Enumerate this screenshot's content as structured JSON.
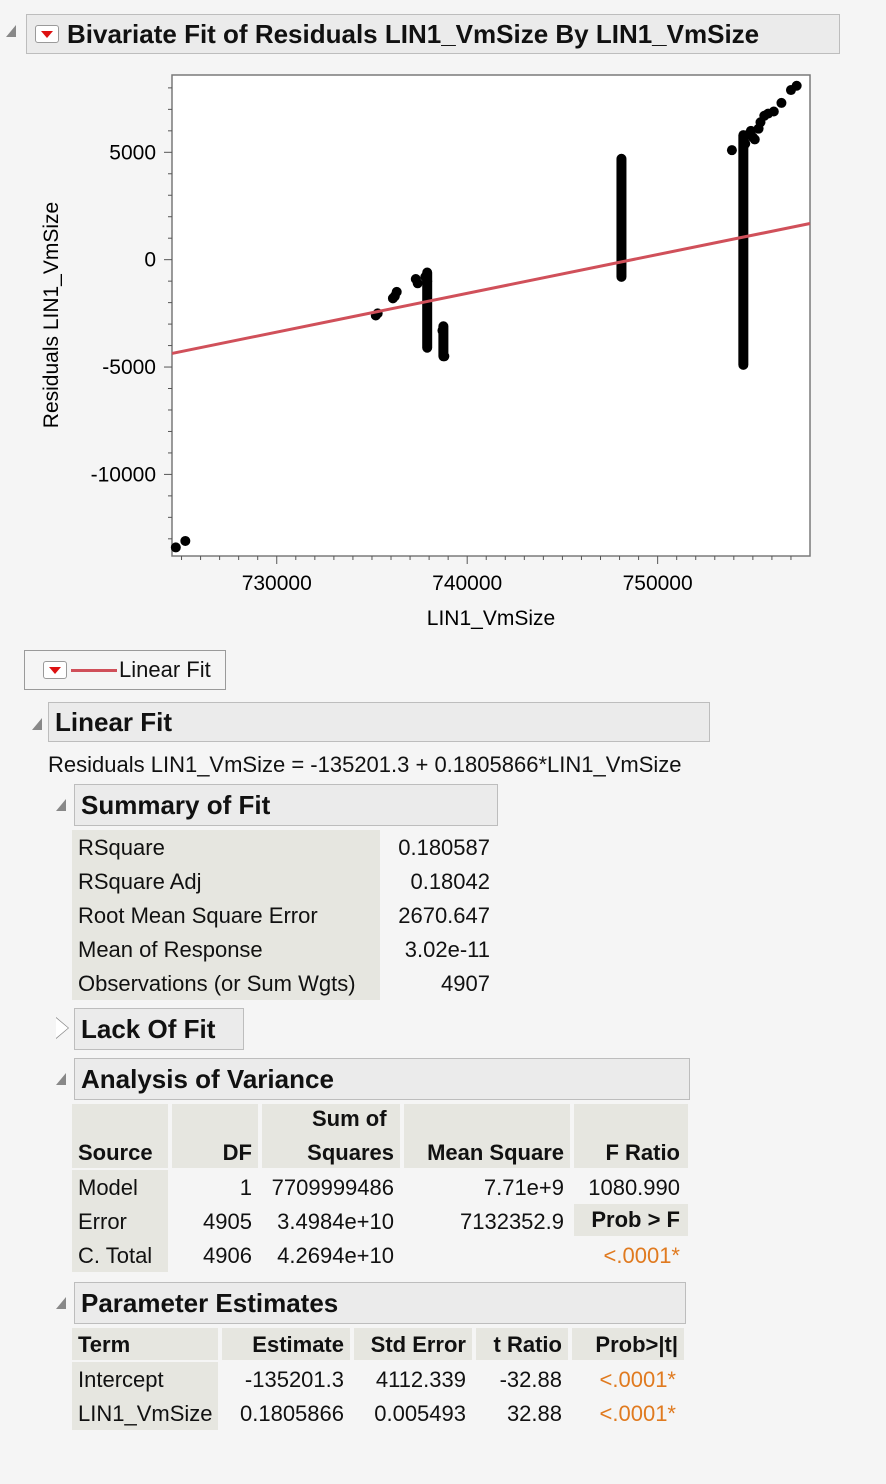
{
  "report": {
    "title": "Bivariate Fit of Residuals LIN1_VmSize By LIN1_VmSize"
  },
  "chart_data": {
    "type": "scatter",
    "xlabel": "LIN1_VmSize",
    "ylabel": "Residuals LIN1_VmSize",
    "xlim": [
      724500,
      758000
    ],
    "ylim": [
      -13800,
      8600
    ],
    "x_ticks": [
      "730000",
      "740000",
      "750000"
    ],
    "x_tick_values": [
      730000,
      740000,
      750000
    ],
    "y_ticks": [
      "5000",
      "0",
      "-5000",
      "-10000"
    ],
    "y_tick_values": [
      5000,
      0,
      -5000,
      -10000
    ],
    "fit_line": {
      "name": "Linear Fit",
      "intercept": -135201.3,
      "slope": 0.1805866,
      "color": "#d0505a"
    },
    "points": [
      [
        724700,
        -13400
      ],
      [
        725200,
        -13100
      ],
      [
        735200,
        -2600
      ],
      [
        735300,
        -2500
      ],
      [
        736200,
        -1700
      ],
      [
        736300,
        -1500
      ],
      [
        736100,
        -1800
      ],
      [
        737300,
        -900
      ],
      [
        737400,
        -1100
      ],
      [
        737800,
        -800
      ],
      [
        737900,
        -1000
      ],
      [
        738700,
        -3300
      ],
      [
        738800,
        -4500
      ],
      [
        753900,
        5100
      ],
      [
        754600,
        5400
      ],
      [
        754700,
        5800
      ],
      [
        754900,
        6000
      ],
      [
        755000,
        5700
      ],
      [
        755100,
        5600
      ],
      [
        755300,
        6100
      ],
      [
        755400,
        6400
      ],
      [
        755600,
        6700
      ],
      [
        755800,
        6800
      ],
      [
        756100,
        6900
      ],
      [
        756500,
        7300
      ],
      [
        757000,
        7900
      ],
      [
        757300,
        8100
      ]
    ],
    "vertical_clusters": [
      {
        "x": 737900,
        "ymin": -4100,
        "ymax": -600
      },
      {
        "x": 738750,
        "ymin": -4500,
        "ymax": -3100
      },
      {
        "x": 748100,
        "ymin": -800,
        "ymax": 4700
      },
      {
        "x": 754500,
        "ymin": -4900,
        "ymax": 5800
      }
    ]
  },
  "legend": {
    "label": "Linear Fit",
    "color": "#d0505a"
  },
  "linear_fit": {
    "title": "Linear Fit",
    "equation": "Residuals LIN1_VmSize = -135201.3 + 0.1805866*LIN1_VmSize"
  },
  "summary_of_fit": {
    "title": "Summary of Fit",
    "rows": [
      {
        "label": "RSquare",
        "value": "0.180587"
      },
      {
        "label": "RSquare Adj",
        "value": "0.18042"
      },
      {
        "label": "Root Mean Square Error",
        "value": "2670.647"
      },
      {
        "label": "Mean of Response",
        "value": "3.02e-11"
      },
      {
        "label": "Observations (or Sum Wgts)",
        "value": "4907"
      }
    ]
  },
  "lack_of_fit": {
    "title": "Lack Of Fit"
  },
  "anova": {
    "title": "Analysis of Variance",
    "headers": {
      "source": "Source",
      "df": "DF",
      "ss_top": "Sum of",
      "ss_bottom": "Squares",
      "ms": "Mean Square",
      "f": "F Ratio"
    },
    "rows": [
      {
        "source": "Model",
        "df": "1",
        "ss": "7709999486",
        "ms": "7.71e+9",
        "f": "1080.990"
      },
      {
        "source": "Error",
        "df": "4905",
        "ss": "3.4984e+10",
        "ms": "7132352.9",
        "f": "Prob > F"
      },
      {
        "source": "C. Total",
        "df": "4906",
        "ss": "4.2694e+10",
        "ms": "",
        "f": "<.0001*"
      }
    ]
  },
  "params": {
    "title": "Parameter Estimates",
    "headers": {
      "term": "Term",
      "estimate": "Estimate",
      "se": "Std Error",
      "t": "t Ratio",
      "p": "Prob>|t|"
    },
    "rows": [
      {
        "term": "Intercept",
        "estimate": "-135201.3",
        "se": "4112.339",
        "t": "-32.88",
        "p": "<.0001*"
      },
      {
        "term": "LIN1_VmSize",
        "estimate": "0.1805866",
        "se": "0.005493",
        "t": "32.88",
        "p": "<.0001*"
      }
    ]
  }
}
